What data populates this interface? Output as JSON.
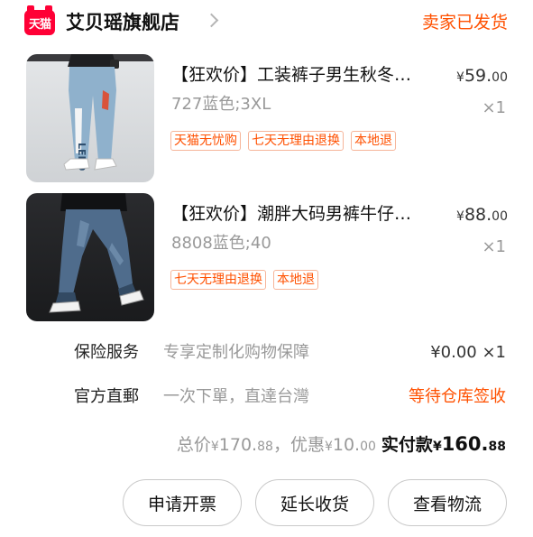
{
  "shop": {
    "logo_text": "天猫",
    "name": "艾贝瑶旗舰店",
    "order_status": "卖家已发货",
    "brand_color": "#ff0036",
    "accent_color": "#ff5000"
  },
  "items": [
    {
      "title": "【狂欢价】工装裤子男生秋冬季男款宽松直筒休闲长裤",
      "price_symbol": "¥",
      "price_int": "59.",
      "price_dec": "00",
      "sku": "727蓝色;3XL",
      "qty": "×1",
      "tags": [
        "天猫无忧购",
        "七天无理由退换",
        "本地退"
      ]
    },
    {
      "title": "【狂欢价】潮胖大码男裤牛仔裤束脚宽松九分裤",
      "price_symbol": "¥",
      "price_int": "88.",
      "price_dec": "00",
      "sku": "8808蓝色;40",
      "qty": "×1",
      "tags": [
        "七天无理由退换",
        "本地退"
      ]
    }
  ],
  "insurance": {
    "label": "保险服务",
    "desc": "专享定制化购物保障",
    "value": "¥0.00 ×1"
  },
  "shipping": {
    "label": "官方直郵",
    "desc": "一次下單，直達台灣",
    "value": "等待仓库签收"
  },
  "totals": {
    "total_label": "总价",
    "yen": "¥",
    "total_int": "170.",
    "total_dec": "88",
    "discount_label": "，优惠",
    "discount_int": "10.",
    "discount_dec": "00",
    "paid_label": "实付款",
    "paid_int": "160.",
    "paid_dec": "88"
  },
  "actions": {
    "invoice": "申请开票",
    "extend": "延长收货",
    "logistics": "查看物流"
  }
}
